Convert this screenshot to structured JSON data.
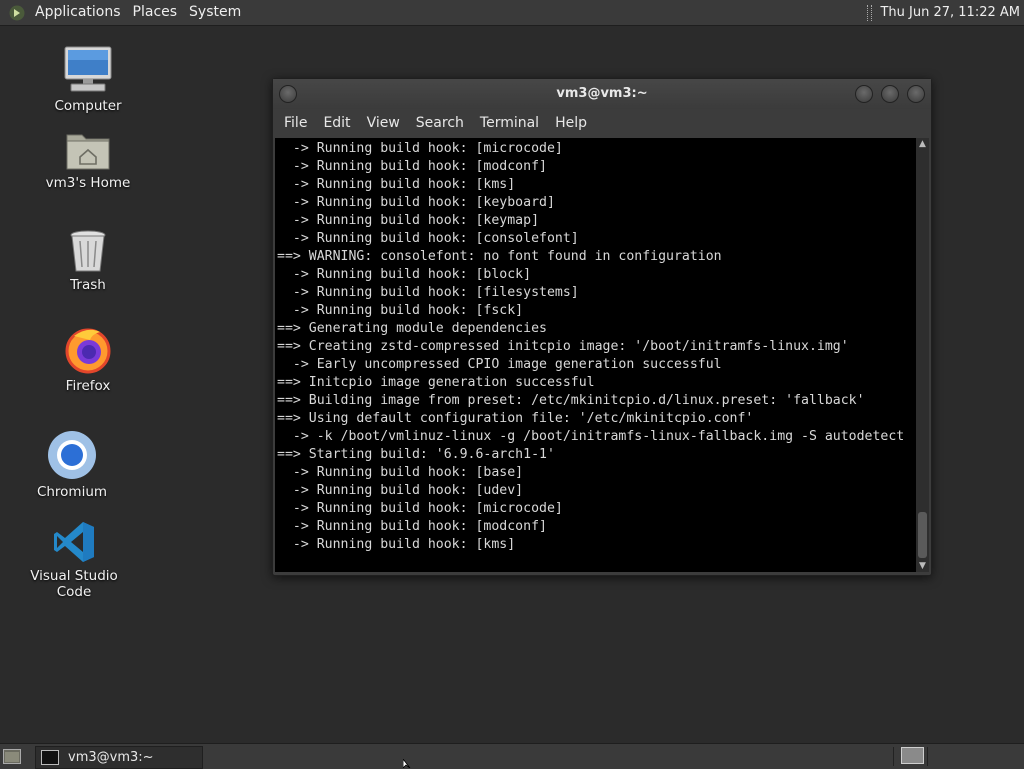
{
  "top_panel": {
    "menu": [
      "Applications",
      "Places",
      "System"
    ],
    "clock": "Thu Jun 27, 11:22 AM"
  },
  "desktop_icons": [
    {
      "label": "Computer",
      "icon": "computer-icon"
    },
    {
      "label": "vm3's Home",
      "icon": "home-folder-icon"
    },
    {
      "label": "Trash",
      "icon": "trash-icon"
    },
    {
      "label": "Firefox",
      "icon": "firefox-icon"
    },
    {
      "label": "Chromium",
      "icon": "chromium-icon"
    },
    {
      "label": "Visual Studio Code",
      "icon": "vscode-icon"
    }
  ],
  "terminal": {
    "title": "vm3@vm3:~",
    "menu": [
      "File",
      "Edit",
      "View",
      "Search",
      "Terminal",
      "Help"
    ],
    "lines": [
      "  -> Running build hook: [microcode]",
      "  -> Running build hook: [modconf]",
      "  -> Running build hook: [kms]",
      "  -> Running build hook: [keyboard]",
      "  -> Running build hook: [keymap]",
      "  -> Running build hook: [consolefont]",
      "==> WARNING: consolefont: no font found in configuration",
      "  -> Running build hook: [block]",
      "  -> Running build hook: [filesystems]",
      "  -> Running build hook: [fsck]",
      "==> Generating module dependencies",
      "==> Creating zstd-compressed initcpio image: '/boot/initramfs-linux.img'",
      "  -> Early uncompressed CPIO image generation successful",
      "==> Initcpio image generation successful",
      "==> Building image from preset: /etc/mkinitcpio.d/linux.preset: 'fallback'",
      "==> Using default configuration file: '/etc/mkinitcpio.conf'",
      "  -> -k /boot/vmlinuz-linux -g /boot/initramfs-linux-fallback.img -S autodetect",
      "==> Starting build: '6.9.6-arch1-1'",
      "  -> Running build hook: [base]",
      "  -> Running build hook: [udev]",
      "  -> Running build hook: [microcode]",
      "  -> Running build hook: [modconf]",
      "  -> Running build hook: [kms]"
    ]
  },
  "taskbar": {
    "tasks": [
      {
        "label": "vm3@vm3:~",
        "icon": "terminal-icon"
      }
    ]
  }
}
